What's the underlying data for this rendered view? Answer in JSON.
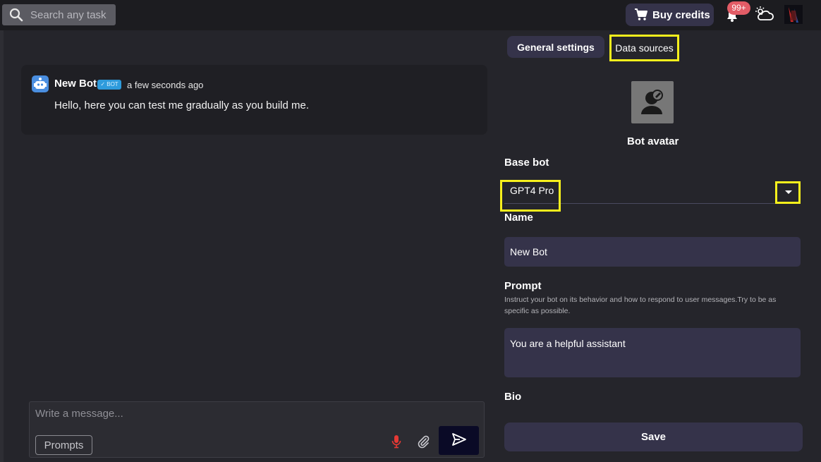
{
  "topbar": {
    "search_placeholder": "Search any task",
    "buy_credits_label": "Buy credits",
    "notification_count": "99+"
  },
  "chat": {
    "bot_name": "New Bot",
    "bot_tag": "✓ BOT",
    "timestamp": "a few seconds ago",
    "message": "Hello, here you can test me gradually as you build me.",
    "composer_placeholder": "Write a message...",
    "prompts_label": "Prompts"
  },
  "settings": {
    "tabs": [
      {
        "label": "General settings"
      },
      {
        "label": "Data sources"
      }
    ],
    "avatar_label": "Bot avatar",
    "base_bot_label": "Base bot",
    "base_bot_value": "GPT4 Pro",
    "name_label": "Name",
    "name_value": "New Bot",
    "prompt_label": "Prompt",
    "prompt_help": "Instruct your bot on its behavior and how to respond to user messages.Try to be as specific as possible.",
    "prompt_value": "You are a helpful assistant",
    "bio_label": "Bio",
    "save_label": "Save"
  },
  "colors": {
    "background": "#25252b",
    "panel": "#1f1f24",
    "accent": "#35334a",
    "highlight": "#f7f01c",
    "badge": "#e25c66"
  }
}
